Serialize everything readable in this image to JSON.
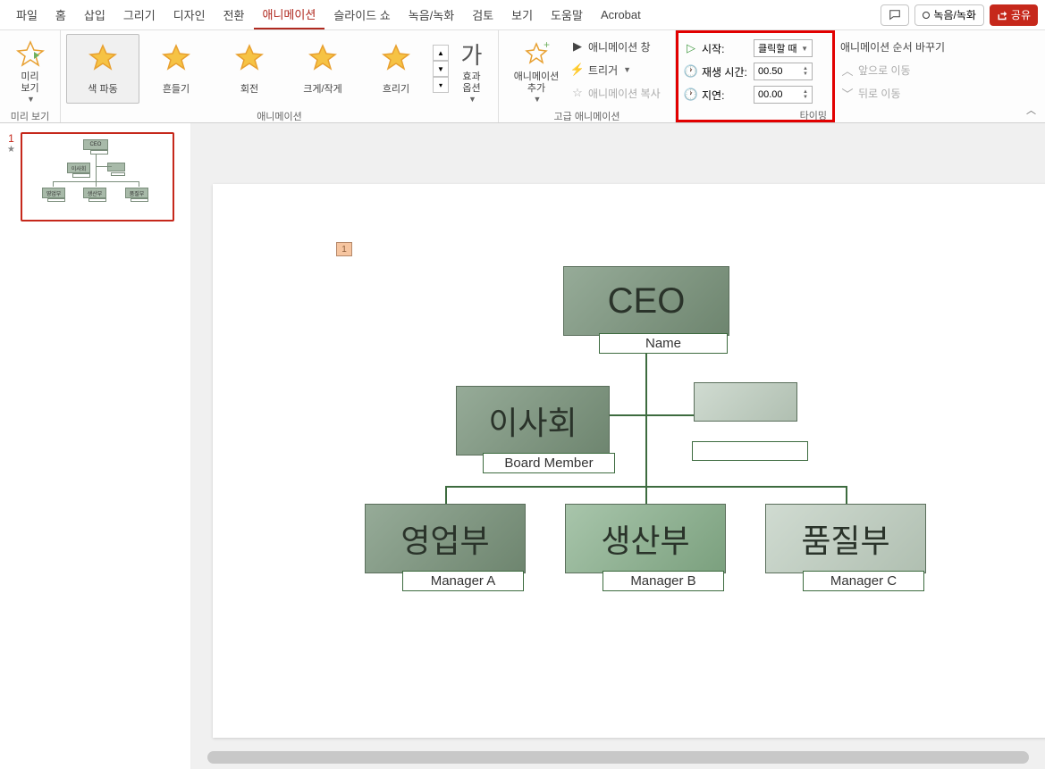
{
  "menubar": {
    "tabs": [
      "파일",
      "홈",
      "삽입",
      "그리기",
      "디자인",
      "전환",
      "애니메이션",
      "슬라이드 쇼",
      "녹음/녹화",
      "검토",
      "보기",
      "도움말",
      "Acrobat"
    ],
    "active_tab_index": 6,
    "record_label": "녹음/녹화",
    "share_label": "공유"
  },
  "ribbon": {
    "preview": {
      "label": "미리\n보기",
      "group_label": "미리 보기"
    },
    "animations": {
      "items": [
        {
          "label": "색 파동"
        },
        {
          "label": "흔들기"
        },
        {
          "label": "회전"
        },
        {
          "label": "크게/작게"
        },
        {
          "label": "흐리기"
        }
      ],
      "selected_index": 0,
      "group_label": "애니메이션"
    },
    "effect_options": {
      "label": "효과\n옵션"
    },
    "advanced": {
      "add_anim": "애니메이션\n추가",
      "pane": "애니메이션 창",
      "trigger": "트리거",
      "copy": "애니메이션 복사",
      "group_label": "고급 애니메이션"
    },
    "timing": {
      "start_label": "시작:",
      "start_value": "클릭할 때",
      "duration_label": "재생 시간:",
      "duration_value": "00.50",
      "delay_label": "지연:",
      "delay_value": "00.00",
      "group_label": "타이밍"
    },
    "reorder": {
      "title": "애니메이션 순서 바꾸기",
      "move_earlier": "앞으로 이동",
      "move_later": "뒤로 이동"
    }
  },
  "slide_panel": {
    "slide_number": "1"
  },
  "org_chart": {
    "anim_tag": "1",
    "ceo": {
      "title": "CEO",
      "sub": "Name"
    },
    "board": {
      "title": "이사회",
      "sub": "Board Member"
    },
    "assistant": {
      "title": "",
      "sub": ""
    },
    "dept1": {
      "title": "영업부",
      "sub": "Manager A"
    },
    "dept2": {
      "title": "생산부",
      "sub": "Manager B"
    },
    "dept3": {
      "title": "품질부",
      "sub": "Manager C"
    }
  }
}
